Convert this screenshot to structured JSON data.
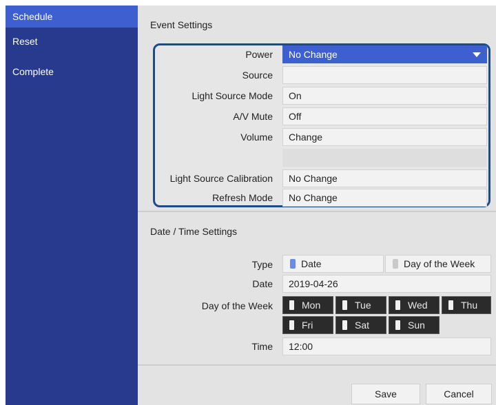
{
  "sidebar": {
    "items": [
      {
        "label": "Schedule",
        "active": true
      },
      {
        "label": "Reset",
        "active": false
      },
      {
        "label": "Complete",
        "active": false
      }
    ]
  },
  "event_settings": {
    "title": "Event Settings",
    "rows": [
      {
        "label": "Power",
        "value": "No Change"
      },
      {
        "label": "Source",
        "value": ""
      },
      {
        "label": "Light Source Mode",
        "value": "On"
      },
      {
        "label": "A/V Mute",
        "value": "Off"
      },
      {
        "label": "Volume",
        "value": "Change"
      },
      {
        "label": "Light Source Calibration",
        "value": "No Change"
      },
      {
        "label": "Refresh Mode",
        "value": "No Change"
      }
    ]
  },
  "datetime_settings": {
    "title": "Date / Time Settings",
    "type_label": "Type",
    "type_options": [
      {
        "label": "Date",
        "selected": true
      },
      {
        "label": "Day of the Week",
        "selected": false
      }
    ],
    "date_label": "Date",
    "date_value": "2019-04-26",
    "dow_label": "Day of the Week",
    "days": [
      "Mon",
      "Tue",
      "Wed",
      "Thu",
      "Fri",
      "Sat",
      "Sun"
    ],
    "time_label": "Time",
    "time_value": "12:00"
  },
  "buttons": {
    "save": "Save",
    "cancel": "Cancel"
  },
  "colors": {
    "sidebar_bg": "#283a8e",
    "sidebar_active": "#3e5fcf",
    "accent_select": "#3d5fcf",
    "frame_border": "#1e4b87",
    "panel_bg": "#e3e3e3"
  }
}
